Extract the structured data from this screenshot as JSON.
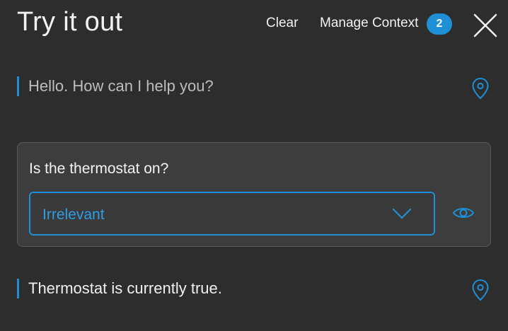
{
  "header": {
    "title": "Try it out",
    "clear_label": "Clear",
    "manage_context_label": "Manage Context",
    "context_count": "2"
  },
  "messages": [
    {
      "text": "Hello. How can I help you?",
      "icon": "location-pin-icon"
    },
    {
      "text": "Thermostat is currently true.",
      "icon": "location-pin-icon"
    }
  ],
  "question_card": {
    "question": "Is the thermostat on?",
    "selected_option": "Irrelevant",
    "dropdown_icon": "chevron-down-icon",
    "view_icon": "eye-icon"
  },
  "colors": {
    "background": "#2d2d2d",
    "card_background": "#3d3d3d",
    "accent": "#1f8fd6",
    "text": "#f2f2f2",
    "muted_text": "#bdbdbd"
  }
}
